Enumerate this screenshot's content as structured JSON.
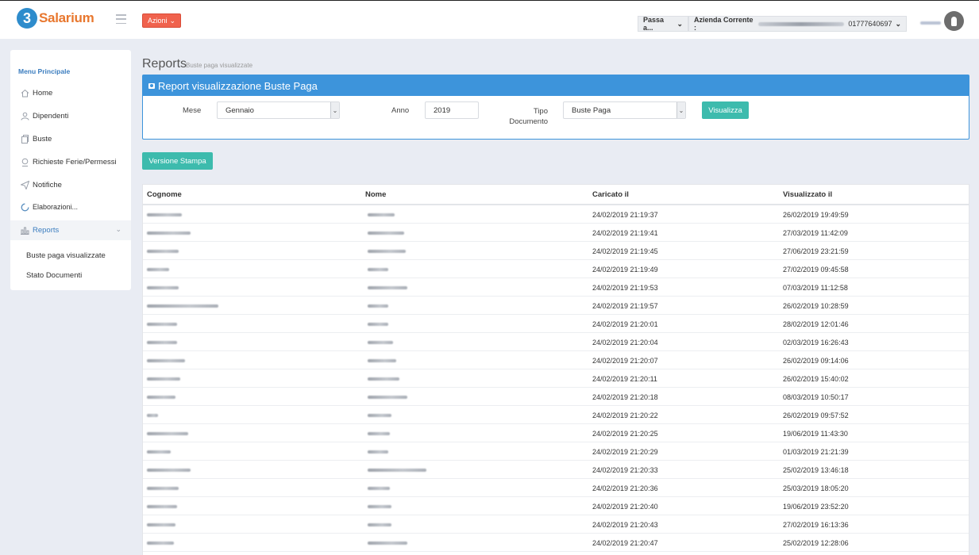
{
  "header": {
    "logo_badge": "3",
    "logo_text": "Salarium",
    "azioni_label": "Azioni",
    "passa_label": "Passa a...",
    "azienda_label": "Azienda Corrente :",
    "azienda_value": "01777640697",
    "brand_color": "#e8772e",
    "badge_color": "#2e8ccc"
  },
  "sidebar": {
    "title": "Menu Principale",
    "items": [
      {
        "label": "Home",
        "icon": "home-icon"
      },
      {
        "label": "Dipendenti",
        "icon": "user-icon"
      },
      {
        "label": "Buste",
        "icon": "document-icon"
      },
      {
        "label": "Richieste Ferie/Permessi",
        "icon": "calendar-icon"
      },
      {
        "label": "Notifiche",
        "icon": "send-icon"
      },
      {
        "label": "Elaborazioni...",
        "icon": "spinner-icon"
      },
      {
        "label": "Reports",
        "icon": "chart-icon"
      }
    ],
    "submenu": [
      {
        "label": "Buste paga visualizzate"
      },
      {
        "label": "Stato Documenti"
      }
    ]
  },
  "page": {
    "title": "Reports",
    "subtitle": "Buste paga visualizzate"
  },
  "panel": {
    "title": "Report visualizzazione Buste Paga",
    "mese_label": "Mese",
    "mese_value": "Gennaio",
    "anno_label": "Anno",
    "anno_value": "2019",
    "tipo_label": "Tipo Documento",
    "tipo_value": "Buste Paga",
    "visualizza_label": "Visualizza",
    "accent_color": "#3d94db"
  },
  "versione_stampa_label": "Versione Stampa",
  "table": {
    "headers": [
      "Cognome",
      "Nome",
      "Caricato il",
      "Visualizzato il"
    ],
    "rows": [
      {
        "caricato": "24/02/2019 21:19:37",
        "visualizzato": "26/02/2019 19:49:59"
      },
      {
        "caricato": "24/02/2019 21:19:41",
        "visualizzato": "27/03/2019 11:42:09"
      },
      {
        "caricato": "24/02/2019 21:19:45",
        "visualizzato": "27/06/2019 23:21:59"
      },
      {
        "caricato": "24/02/2019 21:19:49",
        "visualizzato": "27/02/2019 09:45:58"
      },
      {
        "caricato": "24/02/2019 21:19:53",
        "visualizzato": "07/03/2019 11:12:58"
      },
      {
        "caricato": "24/02/2019 21:19:57",
        "visualizzato": "26/02/2019 10:28:59"
      },
      {
        "caricato": "24/02/2019 21:20:01",
        "visualizzato": "28/02/2019 12:01:46"
      },
      {
        "caricato": "24/02/2019 21:20:04",
        "visualizzato": "02/03/2019 16:26:43"
      },
      {
        "caricato": "24/02/2019 21:20:07",
        "visualizzato": "26/02/2019 09:14:06"
      },
      {
        "caricato": "24/02/2019 21:20:11",
        "visualizzato": "26/02/2019 15:40:02"
      },
      {
        "caricato": "24/02/2019 21:20:18",
        "visualizzato": "08/03/2019 10:50:17"
      },
      {
        "caricato": "24/02/2019 21:20:22",
        "visualizzato": "26/02/2019 09:57:52"
      },
      {
        "caricato": "24/02/2019 21:20:25",
        "visualizzato": "19/06/2019 11:43:30"
      },
      {
        "caricato": "24/02/2019 21:20:29",
        "visualizzato": "01/03/2019 21:21:39"
      },
      {
        "caricato": "24/02/2019 21:20:33",
        "visualizzato": "25/02/2019 13:46:18"
      },
      {
        "caricato": "24/02/2019 21:20:36",
        "visualizzato": "25/03/2019 18:05:20"
      },
      {
        "caricato": "24/02/2019 21:20:40",
        "visualizzato": "19/06/2019 23:52:20"
      },
      {
        "caricato": "24/02/2019 21:20:43",
        "visualizzato": "27/02/2019 16:13:36"
      },
      {
        "caricato": "24/02/2019 21:20:47",
        "visualizzato": "25/02/2019 12:28:06"
      }
    ]
  }
}
